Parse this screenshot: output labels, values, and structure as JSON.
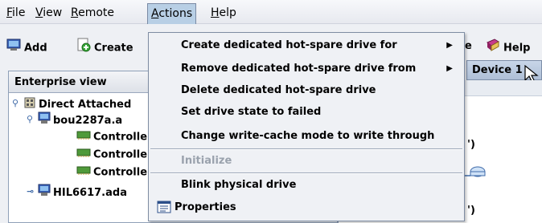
{
  "menubar": {
    "items": [
      {
        "label": "File",
        "mnemonic": "F",
        "rest": "ile"
      },
      {
        "label": "View",
        "mnemonic": "V",
        "rest": "iew"
      },
      {
        "label": "Remote",
        "mnemonic": "R",
        "rest": "emote"
      },
      {
        "label": "Actions",
        "mnemonic": "A",
        "rest": "ctions"
      },
      {
        "label": "Help",
        "mnemonic": "H",
        "rest": "elp"
      }
    ]
  },
  "toolbar": {
    "add_label": "Add",
    "create_label": "Create",
    "partial_e": "e",
    "help_label": "Help"
  },
  "device_tab": {
    "label": "Device 1"
  },
  "enterprise_view": {
    "title": "Enterprise view",
    "tree": [
      {
        "label": "Direct Attached",
        "icon": "building-icon"
      },
      {
        "label": "bou2287a.a",
        "icon": "server-icon"
      },
      {
        "label": "Controlle",
        "icon": "controller-card-icon"
      },
      {
        "label": "Controlle",
        "icon": "controller-card-icon"
      },
      {
        "label": "Controlle",
        "icon": "controller-card-icon"
      },
      {
        "label": "HIL6617.ada",
        "icon": "server-icon"
      }
    ]
  },
  "right_panel": {
    "frag1": "')",
    "frag2": "')"
  },
  "actions_menu": {
    "items": [
      {
        "label": "Create dedicated hot-spare drive for",
        "submenu": true,
        "enabled": true
      },
      {
        "label": "Remove dedicated hot-spare drive from",
        "submenu": true,
        "enabled": true
      },
      {
        "label": "Delete dedicated hot-spare drive",
        "enabled": true
      },
      {
        "label": "Set drive state to failed",
        "enabled": true
      },
      {
        "label": "Change write-cache mode to write through",
        "enabled": true
      },
      {
        "label": "Initialize",
        "enabled": false
      },
      {
        "label": "Blink physical drive",
        "enabled": true
      },
      {
        "label": "Properties",
        "enabled": true,
        "icon": "properties-icon"
      }
    ]
  },
  "colors": {
    "menu_highlight": "#b8cfe5",
    "disabled_text": "#9aa2ad",
    "background": "#eef0f4"
  }
}
